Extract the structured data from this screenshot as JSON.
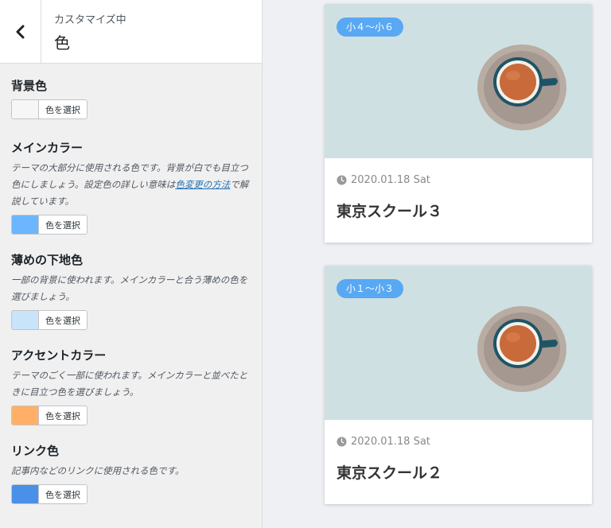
{
  "header": {
    "subtitle": "カスタマイズ中",
    "title": "色"
  },
  "controls": [
    {
      "title": "背景色",
      "desc": "",
      "swatch": "#f6f6f6",
      "button": "色を選択"
    },
    {
      "title": "メインカラー",
      "desc_before": "テーマの大部分に使用される色です。背景が白でも目立つ色にしましょう。設定色の詳しい意味は",
      "desc_link": "色変更の方法",
      "desc_after": "で解説しています。",
      "swatch": "#6bb6ff",
      "button": "色を選択"
    },
    {
      "title": "薄めの下地色",
      "desc": "一部の背景に使われます。メインカラーと合う薄めの色を選びましょう。",
      "swatch": "#c9e3fb",
      "button": "色を選択"
    },
    {
      "title": "アクセントカラー",
      "desc": "テーマのごく一部に使われます。メインカラーと並べたときに目立つ色を選びましょう。",
      "swatch": "#ffb066",
      "button": "色を選択"
    },
    {
      "title": "リンク色",
      "desc": "記事内などのリンクに使用される色です。",
      "swatch": "#4a90e8",
      "button": "色を選択"
    }
  ],
  "posts": [
    {
      "badge": "小４〜小６",
      "date": "2020.01.18 Sat",
      "title": "東京スクール３"
    },
    {
      "badge": "小１〜小３",
      "date": "2020.01.18 Sat",
      "title": "東京スクール２"
    }
  ],
  "colors": {
    "badge_bg": "#58a8f3",
    "thumb_bg": "#cfe0e2"
  }
}
